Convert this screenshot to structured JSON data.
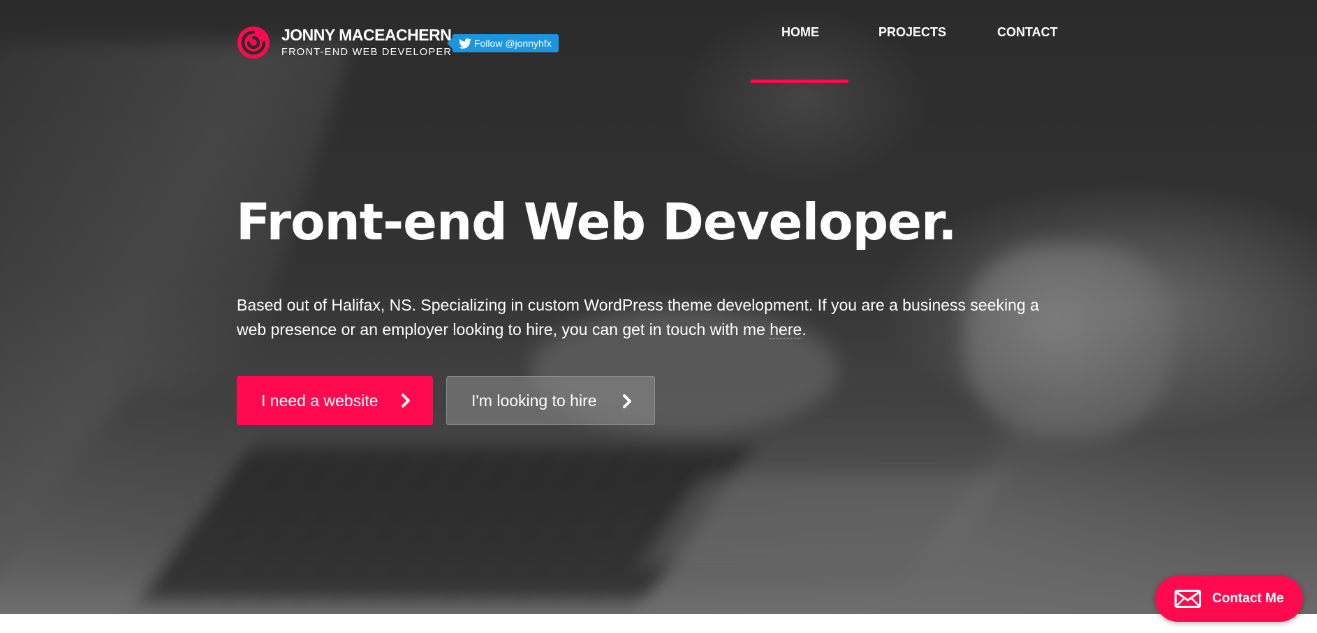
{
  "brand": {
    "name": "JONNY MACEACHERN",
    "tagline": "FRONT-END WEB DEVELOPER",
    "accent_color": "#ff0a4f"
  },
  "twitter": {
    "label": "Follow @jonnyhfx",
    "icon": "twitter-bird-icon",
    "color": "#1b95e0"
  },
  "nav": {
    "items": [
      {
        "label": "HOME",
        "active": true
      },
      {
        "label": "PROJECTS",
        "active": false
      },
      {
        "label": "CONTACT",
        "active": false
      }
    ]
  },
  "hero": {
    "headline": "Front-end Web Developer.",
    "intro_before_link": "Based out of Halifax, NS. Specializing in custom WordPress theme development. If you are a business seeking a web presence or an employer looking to hire, you can get in touch with me ",
    "intro_link": "here",
    "intro_after_link": ".",
    "primary_button": "I need a website",
    "secondary_button": "I'm looking to hire",
    "button_icon": "chevron-right-icon"
  },
  "contact_float": {
    "label": "Contact Me",
    "icon": "envelope-icon"
  }
}
